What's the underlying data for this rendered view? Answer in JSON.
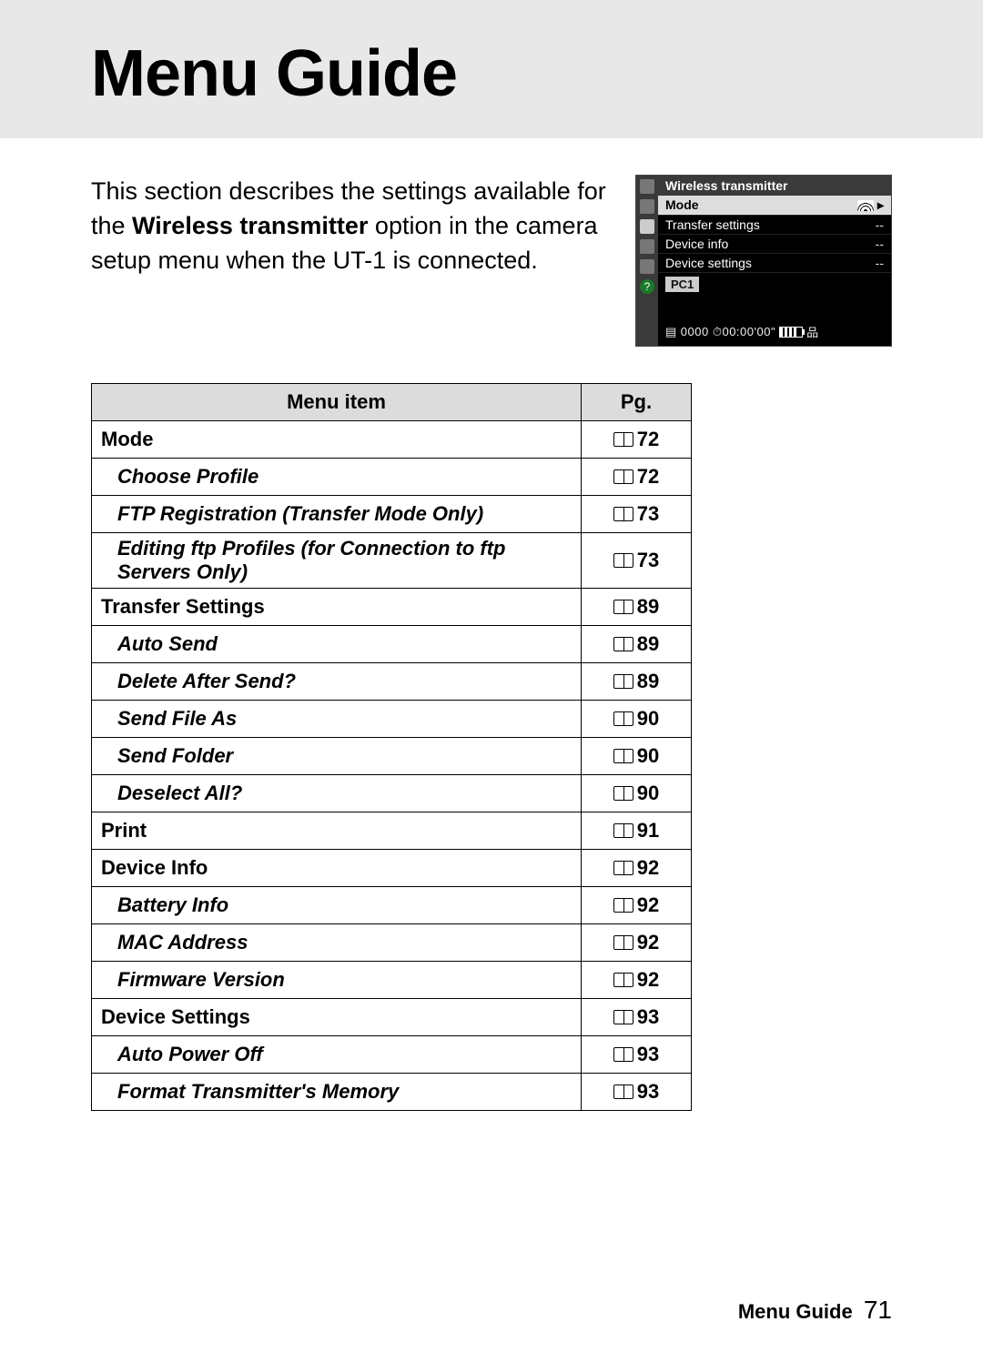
{
  "title": "Menu Guide",
  "intro": {
    "prefix": "This section describes the settings available for the ",
    "bold": "Wireless transmitter",
    "suffix": " option in the camera setup menu when the UT-1 is connected."
  },
  "camera": {
    "header": "Wireless transmitter",
    "rows": [
      {
        "label": "Mode",
        "value": "",
        "selected": true,
        "wifi": true
      },
      {
        "label": "Transfer settings",
        "value": "--"
      },
      {
        "label": "Device info",
        "value": "--"
      },
      {
        "label": "Device settings",
        "value": "--"
      }
    ],
    "profile": "PC1",
    "status": "0000  ⏱00:00'00\""
  },
  "table": {
    "headers": {
      "item": "Menu item",
      "pg": "Pg."
    },
    "rows": [
      {
        "type": "cat",
        "label": "Mode",
        "pg": "72"
      },
      {
        "type": "sub",
        "label": "Choose Profile",
        "pg": "72"
      },
      {
        "type": "sub",
        "label": "FTP Registration (Transfer Mode Only)",
        "pg": "73"
      },
      {
        "type": "sub",
        "label": "Editing ftp Profiles (for Connection to ftp Servers Only)",
        "pg": "73"
      },
      {
        "type": "cat",
        "label": "Transfer Settings",
        "pg": "89"
      },
      {
        "type": "sub",
        "label": "Auto Send",
        "pg": "89"
      },
      {
        "type": "sub",
        "label": "Delete After Send?",
        "pg": "89"
      },
      {
        "type": "sub",
        "label": "Send File As",
        "pg": "90"
      },
      {
        "type": "sub",
        "label": "Send Folder",
        "pg": "90"
      },
      {
        "type": "sub",
        "label": "Deselect All?",
        "pg": "90"
      },
      {
        "type": "cat",
        "label": "Print",
        "pg": "91"
      },
      {
        "type": "cat",
        "label": "Device Info",
        "pg": "92"
      },
      {
        "type": "sub",
        "label": "Battery Info",
        "pg": "92"
      },
      {
        "type": "sub",
        "label": "MAC Address",
        "pg": "92"
      },
      {
        "type": "sub",
        "label": "Firmware Version",
        "pg": "92"
      },
      {
        "type": "cat",
        "label": "Device Settings",
        "pg": "93"
      },
      {
        "type": "sub",
        "label": "Auto Power Off",
        "pg": "93"
      },
      {
        "type": "sub",
        "label": "Format Transmitter's Memory",
        "pg": "93"
      }
    ]
  },
  "footer": {
    "label": "Menu Guide",
    "page": "71"
  }
}
